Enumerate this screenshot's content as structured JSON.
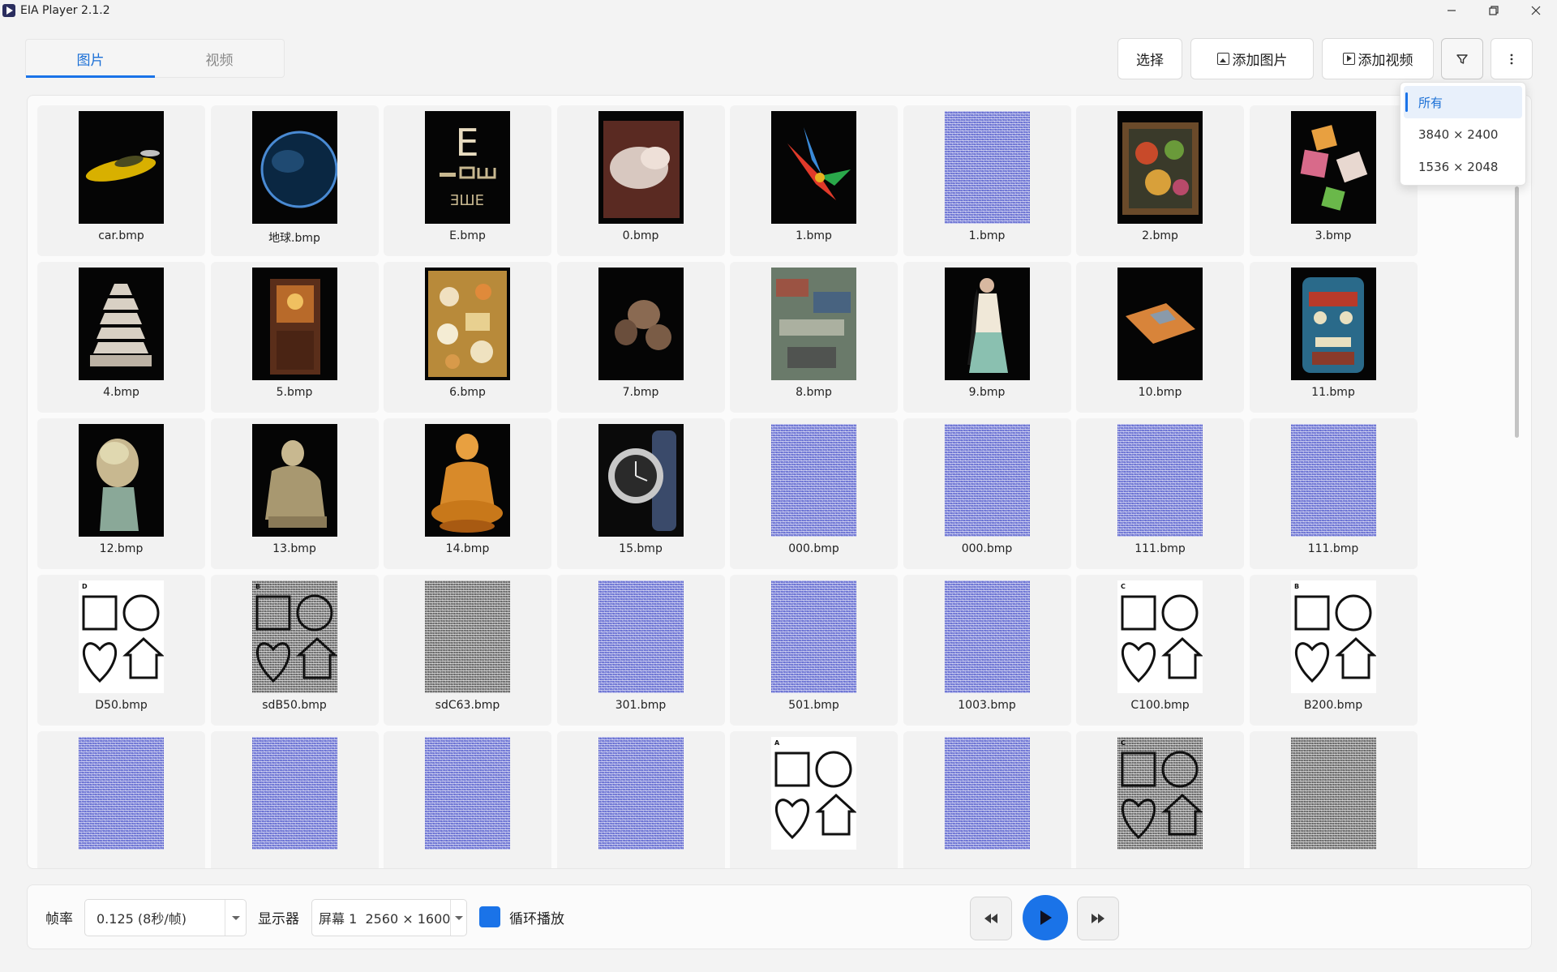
{
  "app": {
    "title": "EIA Player 2.1.2"
  },
  "window_controls": {
    "minimize": "—",
    "maximize": "❐",
    "close": "✕"
  },
  "tabs": [
    {
      "label": "图片",
      "active": true
    },
    {
      "label": "视频",
      "active": false
    }
  ],
  "toolbar": {
    "select_label": "选择",
    "add_image_label": "添加图片",
    "add_video_label": "添加视频",
    "filter_icon": "filter-icon",
    "more_icon": "more-vertical-icon"
  },
  "filter_menu": {
    "items": [
      {
        "label": "所有",
        "selected": true
      },
      {
        "label": "3840 × 2400",
        "selected": false
      },
      {
        "label": "1536 × 2048",
        "selected": false
      }
    ]
  },
  "gallery": {
    "items": [
      {
        "label": "car.bmp",
        "thumb": "car"
      },
      {
        "label": "地球.bmp",
        "thumb": "earth"
      },
      {
        "label": "E.bmp",
        "thumb": "eye-chart"
      },
      {
        "label": "0.bmp",
        "thumb": "relief"
      },
      {
        "label": "1.bmp",
        "thumb": "bird"
      },
      {
        "label": "1.bmp",
        "thumb": "noise"
      },
      {
        "label": "2.bmp",
        "thumb": "painting"
      },
      {
        "label": "3.bmp",
        "thumb": "cubes"
      },
      {
        "label": "4.bmp",
        "thumb": "pagoda"
      },
      {
        "label": "5.bmp",
        "thumb": "cabinet"
      },
      {
        "label": "6.bmp",
        "thumb": "food-box"
      },
      {
        "label": "7.bmp",
        "thumb": "barrels"
      },
      {
        "label": "8.bmp",
        "thumb": "city"
      },
      {
        "label": "9.bmp",
        "thumb": "figure"
      },
      {
        "label": "10.bmp",
        "thumb": "taxi"
      },
      {
        "label": "11.bmp",
        "thumb": "mask"
      },
      {
        "label": "12.bmp",
        "thumb": "bust"
      },
      {
        "label": "13.bmp",
        "thumb": "statue"
      },
      {
        "label": "14.bmp",
        "thumb": "buddha"
      },
      {
        "label": "15.bmp",
        "thumb": "watch"
      },
      {
        "label": "000.bmp",
        "thumb": "noise"
      },
      {
        "label": "000.bmp",
        "thumb": "noise"
      },
      {
        "label": "111.bmp",
        "thumb": "noise"
      },
      {
        "label": "111.bmp",
        "thumb": "noise"
      },
      {
        "label": "D50.bmp",
        "thumb": "shapes",
        "letter": "D"
      },
      {
        "label": "sdB50.bmp",
        "thumb": "shapes-noise",
        "letter": "B"
      },
      {
        "label": "sdC63.bmp",
        "thumb": "gray-noise"
      },
      {
        "label": "301.bmp",
        "thumb": "noise"
      },
      {
        "label": "501.bmp",
        "thumb": "noise"
      },
      {
        "label": "1003.bmp",
        "thumb": "noise"
      },
      {
        "label": "C100.bmp",
        "thumb": "shapes",
        "letter": "C"
      },
      {
        "label": "B200.bmp",
        "thumb": "shapes",
        "letter": "B"
      },
      {
        "label": "",
        "thumb": "noise"
      },
      {
        "label": "",
        "thumb": "noise"
      },
      {
        "label": "",
        "thumb": "noise"
      },
      {
        "label": "",
        "thumb": "noise"
      },
      {
        "label": "",
        "thumb": "shapes",
        "letter": "A"
      },
      {
        "label": "",
        "thumb": "noise"
      },
      {
        "label": "",
        "thumb": "shapes-noise",
        "letter": "C"
      },
      {
        "label": "",
        "thumb": "gray-noise"
      }
    ]
  },
  "bottom_bar": {
    "frame_rate_label": "帧率",
    "frame_rate_value": "0.125 (8秒/帧)",
    "display_label": "显示器",
    "display_value": "屏幕 1  2560 × 1600",
    "loop_label": "循环播放",
    "loop_checked": true,
    "prev_icon": "rewind-icon",
    "play_icon": "play-icon",
    "next_icon": "fast-forward-icon"
  },
  "colors": {
    "accent": "#1a73e8",
    "noise_blue": "#8b91e0"
  }
}
